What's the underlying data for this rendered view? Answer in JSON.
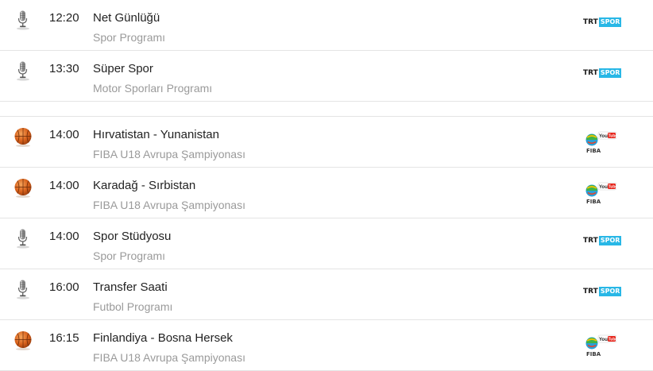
{
  "icons": {
    "microphone": "microphone-icon",
    "basketball": "basketball-icon"
  },
  "logos": {
    "trt_spor": {
      "part1": "TRT",
      "part2": "SPOR",
      "accent": "#28b7e6"
    },
    "fiba_youtube": {
      "text": "FIBA",
      "badge": "You Tube",
      "accent": "#e62117"
    }
  },
  "rows": [
    {
      "kind": "mic",
      "time": "12:20",
      "title": "Net Günlüğü",
      "subtitle": "Spor Programı",
      "channel": "trt"
    },
    {
      "kind": "mic",
      "time": "13:30",
      "title": "Süper Spor",
      "subtitle": "Motor Sporları Programı",
      "channel": "trt"
    },
    {
      "kind": "divider"
    },
    {
      "kind": "ball",
      "time": "14:00",
      "title": "Hırvatistan - Yunanistan",
      "subtitle": "FIBA U18 Avrupa Şampiyonası",
      "channel": "fiba"
    },
    {
      "kind": "ball",
      "time": "14:00",
      "title": "Karadağ - Sırbistan",
      "subtitle": "FIBA U18 Avrupa Şampiyonası",
      "channel": "fiba"
    },
    {
      "kind": "mic",
      "time": "14:00",
      "title": "Spor Stüdyosu",
      "subtitle": "Spor Programı",
      "channel": "trt"
    },
    {
      "kind": "mic",
      "time": "16:00",
      "title": "Transfer Saati",
      "subtitle": "Futbol Programı",
      "channel": "trt"
    },
    {
      "kind": "ball",
      "time": "16:15",
      "title": "Finlandiya - Bosna Hersek",
      "subtitle": "FIBA U18 Avrupa Şampiyonası",
      "channel": "fiba"
    }
  ]
}
